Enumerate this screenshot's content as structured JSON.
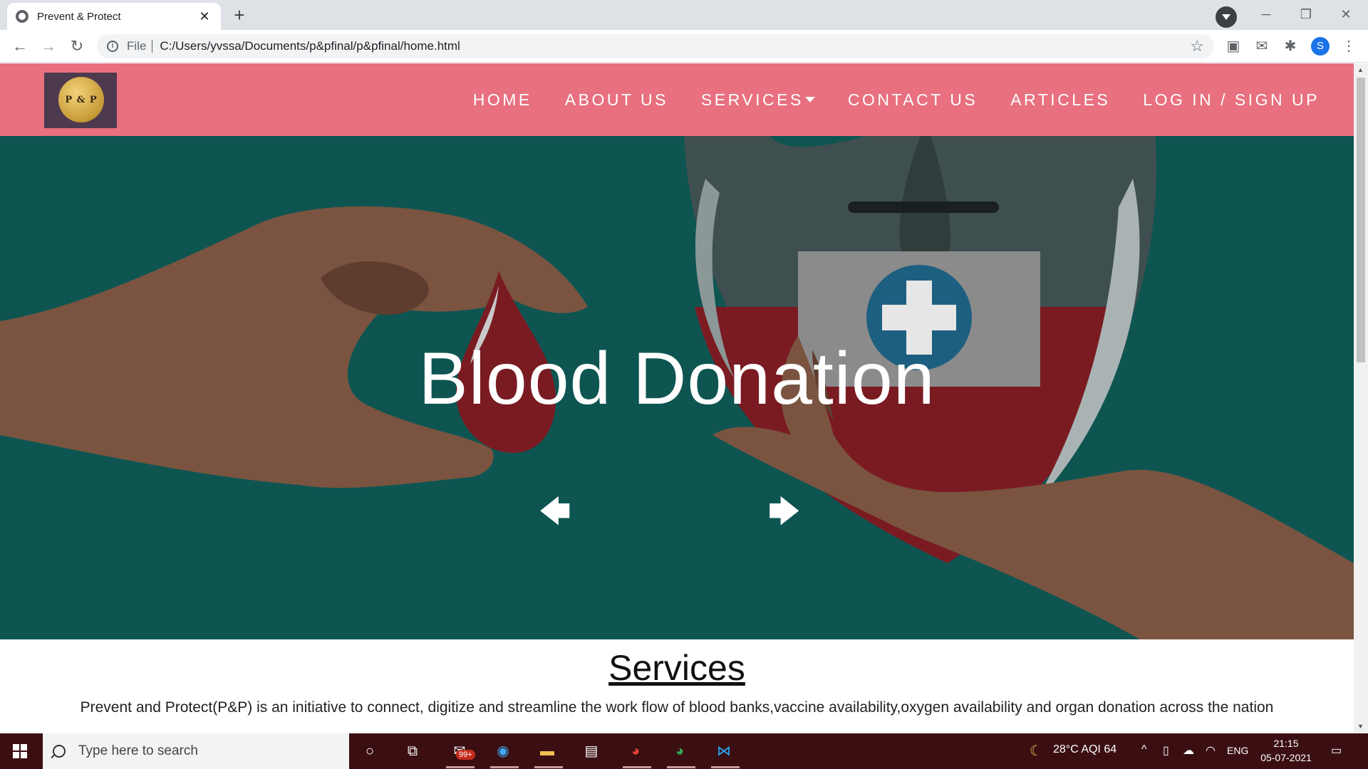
{
  "browser": {
    "tab_title": "Prevent & Protect",
    "tab_close": "✕",
    "new_tab": "+",
    "scheme": "File",
    "url": "C:/Users/yvssa/Documents/p&pfinal/p&pfinal/home.html",
    "profile_initial": "S"
  },
  "site": {
    "logo_text": "P & P",
    "menu": {
      "home": "HOME",
      "about": "ABOUT US",
      "services": "SERVICES",
      "contact": "CONTACT US",
      "articles": "ARTICLES",
      "login": "LOG IN / SIGN UP"
    },
    "hero": {
      "title": "Blood Donation",
      "prev": "🡄",
      "next": "🡆"
    },
    "services": {
      "title": "Services",
      "description": "Prevent and Protect(P&P) is an initiative to connect, digitize and streamline the work flow of blood banks,vaccine availability,oxygen availability and organ donation across the nation"
    }
  },
  "taskbar": {
    "search_placeholder": "Type here to search",
    "mail_badge": "99+",
    "weather": "28°C AQI 64",
    "language": "ENG",
    "time": "21:15",
    "date": "05-07-2021"
  },
  "colors": {
    "nav_bg": "#e8707f",
    "hero_bg": "#0e5552",
    "taskbar_bg": "#3b0f12"
  }
}
